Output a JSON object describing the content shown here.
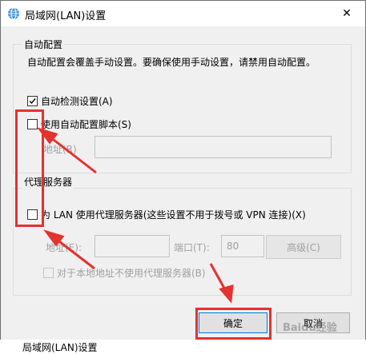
{
  "window": {
    "title": "局域网(LAN)设置",
    "close_symbol": "✕"
  },
  "auto_config": {
    "group_title": "自动配置",
    "description": "自动配置会覆盖手动设置。要确保使用手动设置，请禁用自动配置。",
    "auto_detect": {
      "label": "自动检测设置(A)",
      "checked": true
    },
    "use_script": {
      "label": "使用自动配置脚本(S)",
      "checked": false
    },
    "address_label": "地址(R)",
    "address_value": ""
  },
  "proxy": {
    "group_title": "代理服务器",
    "use_proxy": {
      "label": "为 LAN 使用代理服务器(这些设置不用于拨号或 VPN 连接)(X)",
      "checked": false
    },
    "address_label": "地址(E):",
    "address_value": "",
    "port_label": "端口(T):",
    "port_value": "80",
    "advanced_label": "高级(C)",
    "bypass_local": {
      "label": "对于本地地址不使用代理服务器(B)",
      "checked": false
    }
  },
  "buttons": {
    "ok": "确定",
    "cancel": "取消"
  },
  "background_text": "局域网(LAN)设置",
  "watermark": "Baidu经验",
  "colors": {
    "annotation_red": "#e3322f",
    "accent": "#0078d7"
  }
}
